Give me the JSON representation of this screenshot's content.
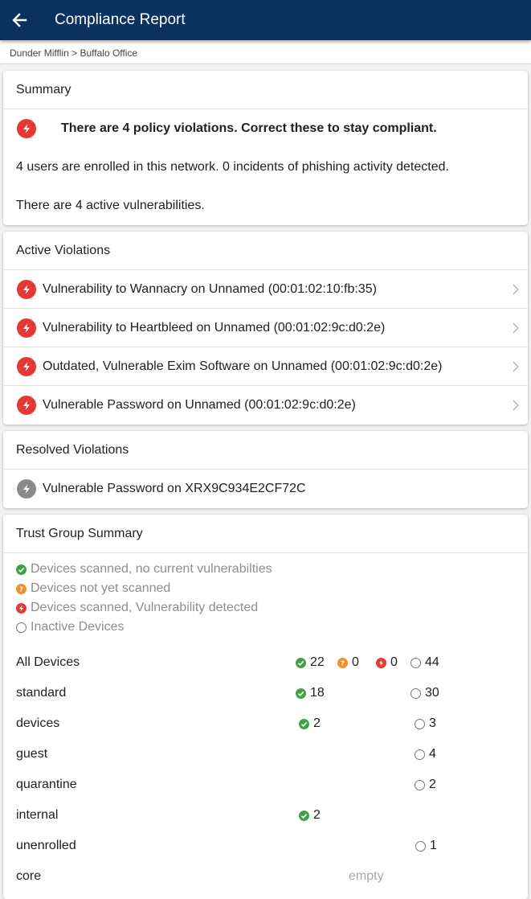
{
  "header": {
    "title": "Compliance Report"
  },
  "breadcrumb": "Dunder Mifflin > Buffalo Office",
  "summary": {
    "title": "Summary",
    "alert": "There are 4 policy violations. Correct these to stay compliant.",
    "line1": "4 users are enrolled in this network. 0 incidents of phishing activity detected.",
    "line2": "There are 4 active vulnerabilities."
  },
  "active": {
    "title": "Active Violations",
    "items": [
      "Vulnerability to Wannacry on Unnamed (00:01:02:10:fb:35)",
      "Vulnerability to Heartbleed on Unnamed (00:01:02:9c:d0:2e)",
      "Outdated, Vulnerable Exim Software on Unnamed (00:01:02:9c:d0:2e)",
      "Vulnerable Password on Unnamed (00:01:02:9c:d0:2e)"
    ]
  },
  "resolved": {
    "title": "Resolved Violations",
    "items": [
      "Vulnerable Password on XRX9C934E2CF72C"
    ]
  },
  "trust": {
    "title": "Trust Group Summary",
    "legend": {
      "ok": "Devices scanned, no current vulnerabilties",
      "pending": "Devices not yet scanned",
      "vuln": "Devices scanned, Vulnerability detected",
      "inactive": "Inactive Devices"
    },
    "groups": [
      {
        "name": "All Devices",
        "ok": "22",
        "pending": "0",
        "vuln": "0",
        "inactive": "44"
      },
      {
        "name": "standard",
        "ok": "18",
        "inactive": "30"
      },
      {
        "name": "devices",
        "ok": "2",
        "inactive": "3"
      },
      {
        "name": "guest",
        "inactive": "4"
      },
      {
        "name": "quarantine",
        "inactive": "2"
      },
      {
        "name": "internal",
        "ok": "2"
      },
      {
        "name": "unenrolled",
        "inactive": "1"
      },
      {
        "name": "core",
        "empty": "empty"
      }
    ]
  },
  "colors": {
    "appbar": "#0b3160",
    "alert": "#e53935",
    "ok": "#43a047",
    "pending": "#f0902e",
    "resolved": "#8a8a8a"
  }
}
